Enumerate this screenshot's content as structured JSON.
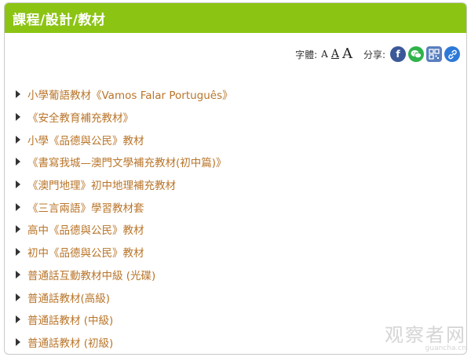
{
  "header": {
    "title": "課程/設計/教材"
  },
  "toolbar": {
    "font_size_label": "字體:",
    "font_small": "A",
    "font_medium": "A",
    "font_large": "A",
    "share_label": "分享:",
    "share_icons": [
      "facebook-icon",
      "wechat-icon",
      "qrcode-icon",
      "link-icon"
    ]
  },
  "list": {
    "items": [
      "小學葡語教材《Vamos Falar Português》",
      "《安全教育補充教材》",
      "小學《品德與公民》教材",
      "《書寫我城—澳門文學補充教材(初中篇)》",
      "《澳門地理》初中地理補充教材",
      "《三言兩語》學習教材套",
      "高中《品德與公民》教材",
      "初中《品德與公民》教材",
      "普通話互動教材中級 (光碟)",
      "普通話教材(高級)",
      "普通話教材 (中級)",
      "普通話教材 (初級)"
    ]
  },
  "watermark": {
    "cn": "观察者网",
    "en": "guancha.cn"
  },
  "colors": {
    "header_bg": "#8cc414",
    "link": "#b9752a",
    "facebook": "#3b5998",
    "wechat": "#2fb34a"
  }
}
